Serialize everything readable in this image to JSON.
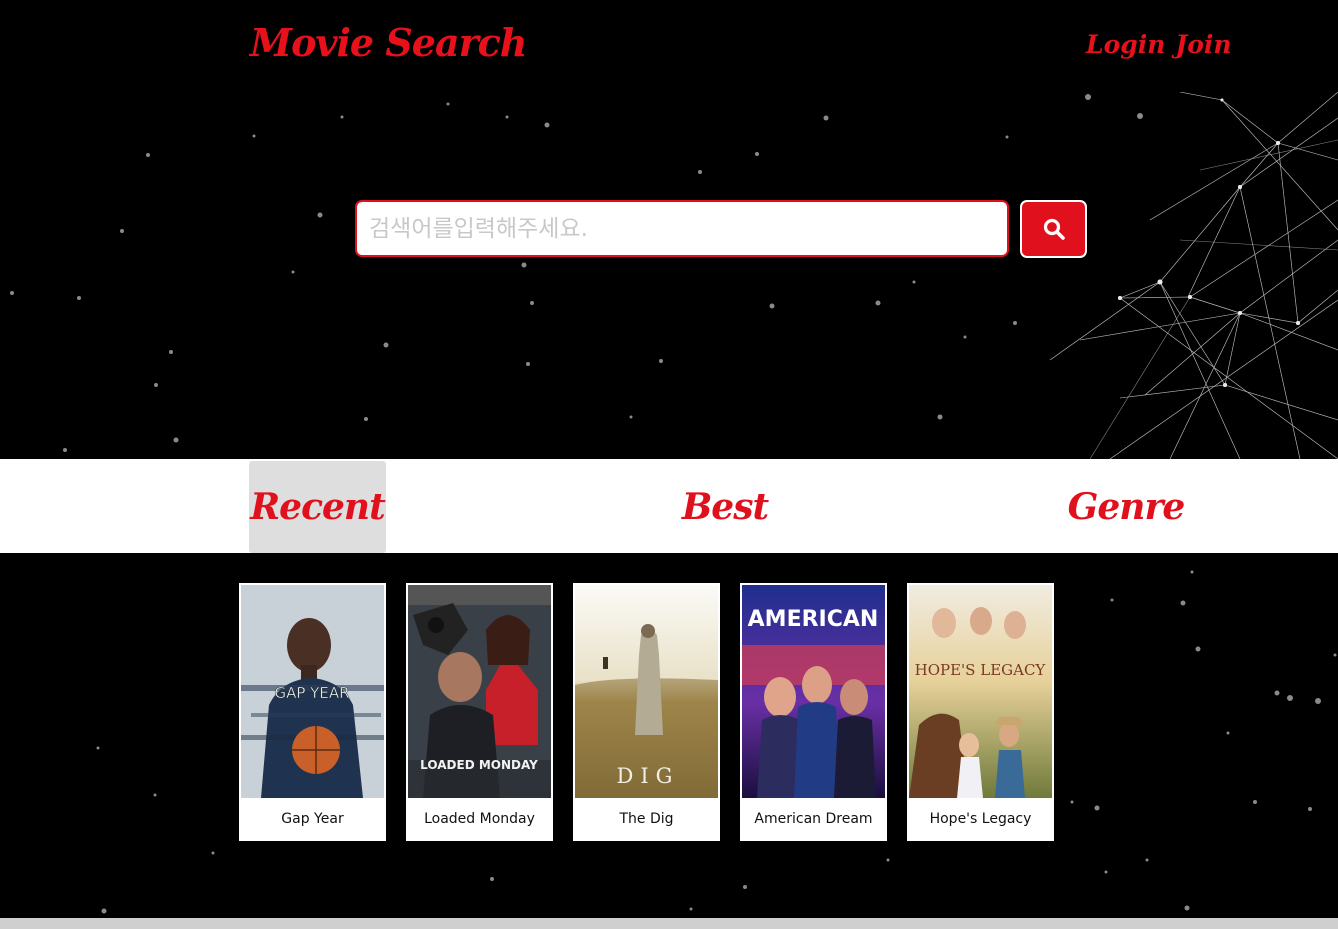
{
  "header": {
    "logo": "Movie Search",
    "login_label": "Login",
    "join_label": "Join"
  },
  "search": {
    "placeholder": "검색어를입력해주세요.",
    "value": "",
    "button_icon": "search-icon"
  },
  "tabs": [
    {
      "label": "Recent",
      "active": true
    },
    {
      "label": "Best",
      "active": false
    },
    {
      "label": "Genre",
      "active": false
    }
  ],
  "movies": [
    {
      "title": "Gap Year",
      "poster_text": "GAP YEAR"
    },
    {
      "title": "Loaded Monday",
      "poster_text": "LOADED MONDAY"
    },
    {
      "title": "The Dig",
      "poster_text": "DIG"
    },
    {
      "title": "American Dream",
      "poster_text": "AMERICAN"
    },
    {
      "title": "Hope's Legacy",
      "poster_text": "HOPE'S LEGACY"
    }
  ],
  "colors": {
    "accent": "#e0111c",
    "background": "#000000",
    "tab_bar": "#ffffff",
    "active_tab": "#dedede"
  }
}
